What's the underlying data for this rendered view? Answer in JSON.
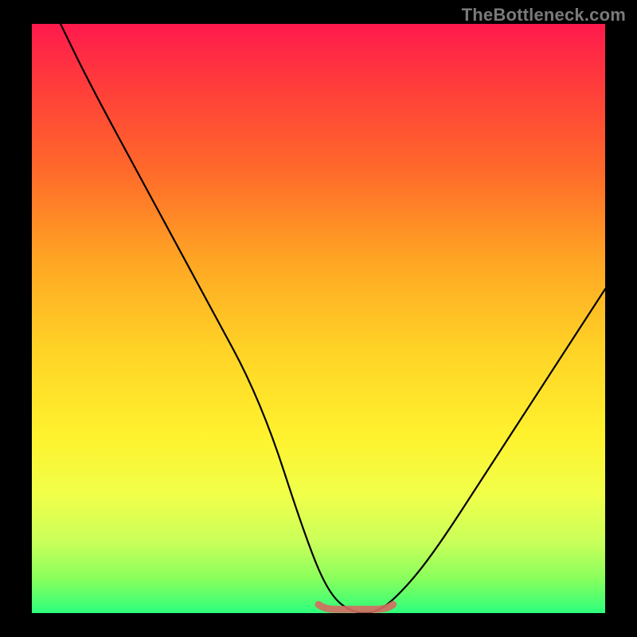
{
  "watermark": "TheBottleneck.com",
  "chart_data": {
    "type": "line",
    "title": "",
    "xlabel": "",
    "ylabel": "",
    "xlim": [
      0,
      100
    ],
    "ylim": [
      0,
      100
    ],
    "grid": false,
    "legend": false,
    "series": [
      {
        "name": "bottleneck-curve",
        "x": [
          5,
          10,
          20,
          30,
          40,
          48,
          52,
          56,
          60,
          64,
          70,
          80,
          90,
          100
        ],
        "y": [
          100,
          90,
          72,
          54,
          36,
          12,
          3,
          0,
          0,
          3,
          10,
          25,
          40,
          55
        ]
      }
    ],
    "annotations": [
      {
        "name": "sweet-spot-marker",
        "type": "range",
        "axis": "x",
        "from": 50,
        "to": 63,
        "color": "#d66a60"
      }
    ],
    "background_gradient": [
      "#ff1a4d",
      "#ff3b3b",
      "#ff6a2a",
      "#ffa524",
      "#ffd226",
      "#fff22e",
      "#f0ff4a",
      "#c9ff5a",
      "#8bff5c",
      "#2cff7c"
    ]
  }
}
